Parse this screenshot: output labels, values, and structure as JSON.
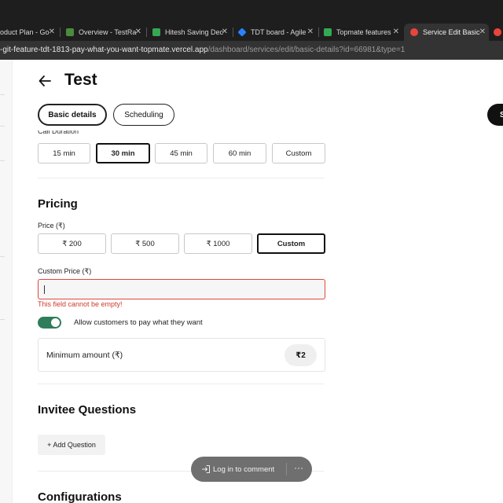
{
  "browser": {
    "tabs": [
      {
        "label": "oduct Plan - Go",
        "color": "#6b6b6b"
      },
      {
        "label": "Overview - TestRa",
        "color": "#4b8b3b"
      },
      {
        "label": "Hitesh Saving Dec",
        "color": "#34a853"
      },
      {
        "label": "TDT board - Agile",
        "color": "#2684ff"
      },
      {
        "label": "Topmate features",
        "color": "#34a853"
      },
      {
        "label": "Service Edit Basic",
        "color": "#e8453c"
      }
    ],
    "url_host": "-git-feature-tdt-1813-pay-what-you-want-topmate.vercel.app",
    "url_path": "/dashboard/services/edit/basic-details?id=66981&type=1"
  },
  "header": {
    "title": "Test",
    "tabs": [
      "Basic details",
      "Scheduling"
    ],
    "save_label": "S"
  },
  "duration": {
    "label": "Call Duration",
    "options": [
      "15 min",
      "30 min",
      "45 min",
      "60 min",
      "Custom"
    ],
    "selected": "30 min"
  },
  "pricing": {
    "heading": "Pricing",
    "price_label": "Price (₹)",
    "options": [
      "₹ 200",
      "₹ 500",
      "₹ 1000",
      "Custom"
    ],
    "selected": "Custom",
    "custom_label": "Custom Price (₹)",
    "custom_value": "",
    "error": "This field cannot be empty!",
    "toggle_label": "Allow customers to pay what they want",
    "toggle_on": true,
    "min_label": "Minimum amount (₹)",
    "min_value": "₹2"
  },
  "invitee": {
    "heading": "Invitee Questions",
    "add_label": "+ Add Question"
  },
  "comment": {
    "label": "Log in to comment",
    "more": "···"
  },
  "configurations": {
    "heading": "Configurations"
  },
  "colors": {
    "accent_toggle": "#2e7d5b",
    "error": "#d0392d"
  }
}
